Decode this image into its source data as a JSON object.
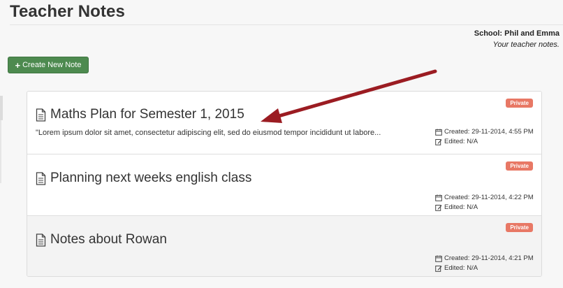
{
  "page": {
    "title": "Teacher Notes",
    "school_label": "School: Phil and Emma",
    "subtitle": "Your teacher notes."
  },
  "toolbar": {
    "create_icon": "plus",
    "create_label": "Create New Note",
    "accent": "#4d8a4f"
  },
  "notes": [
    {
      "title": "Maths Plan for Semester 1, 2015",
      "excerpt": "\"Lorem ipsum dolor sit amet, consectetur adipiscing elit, sed do eiusmod tempor incididunt ut labore...",
      "badge": "Private",
      "created": "Created: 29-11-2014, 4:55 PM",
      "edited": "Edited: N/A"
    },
    {
      "title": "Planning next weeks english class",
      "excerpt": "",
      "badge": "Private",
      "created": "Created: 29-11-2014, 4:22 PM",
      "edited": "Edited: N/A"
    },
    {
      "title": "Notes about Rowan",
      "excerpt": "",
      "badge": "Private",
      "created": "Created: 29-11-2014, 4:21 PM",
      "edited": "Edited: N/A"
    }
  ],
  "colors": {
    "badge": "#e87865",
    "annotation_arrow": "#9b1c22"
  },
  "icons": {
    "note": "document-icon",
    "created": "calendar-icon",
    "edited": "edit-icon"
  }
}
